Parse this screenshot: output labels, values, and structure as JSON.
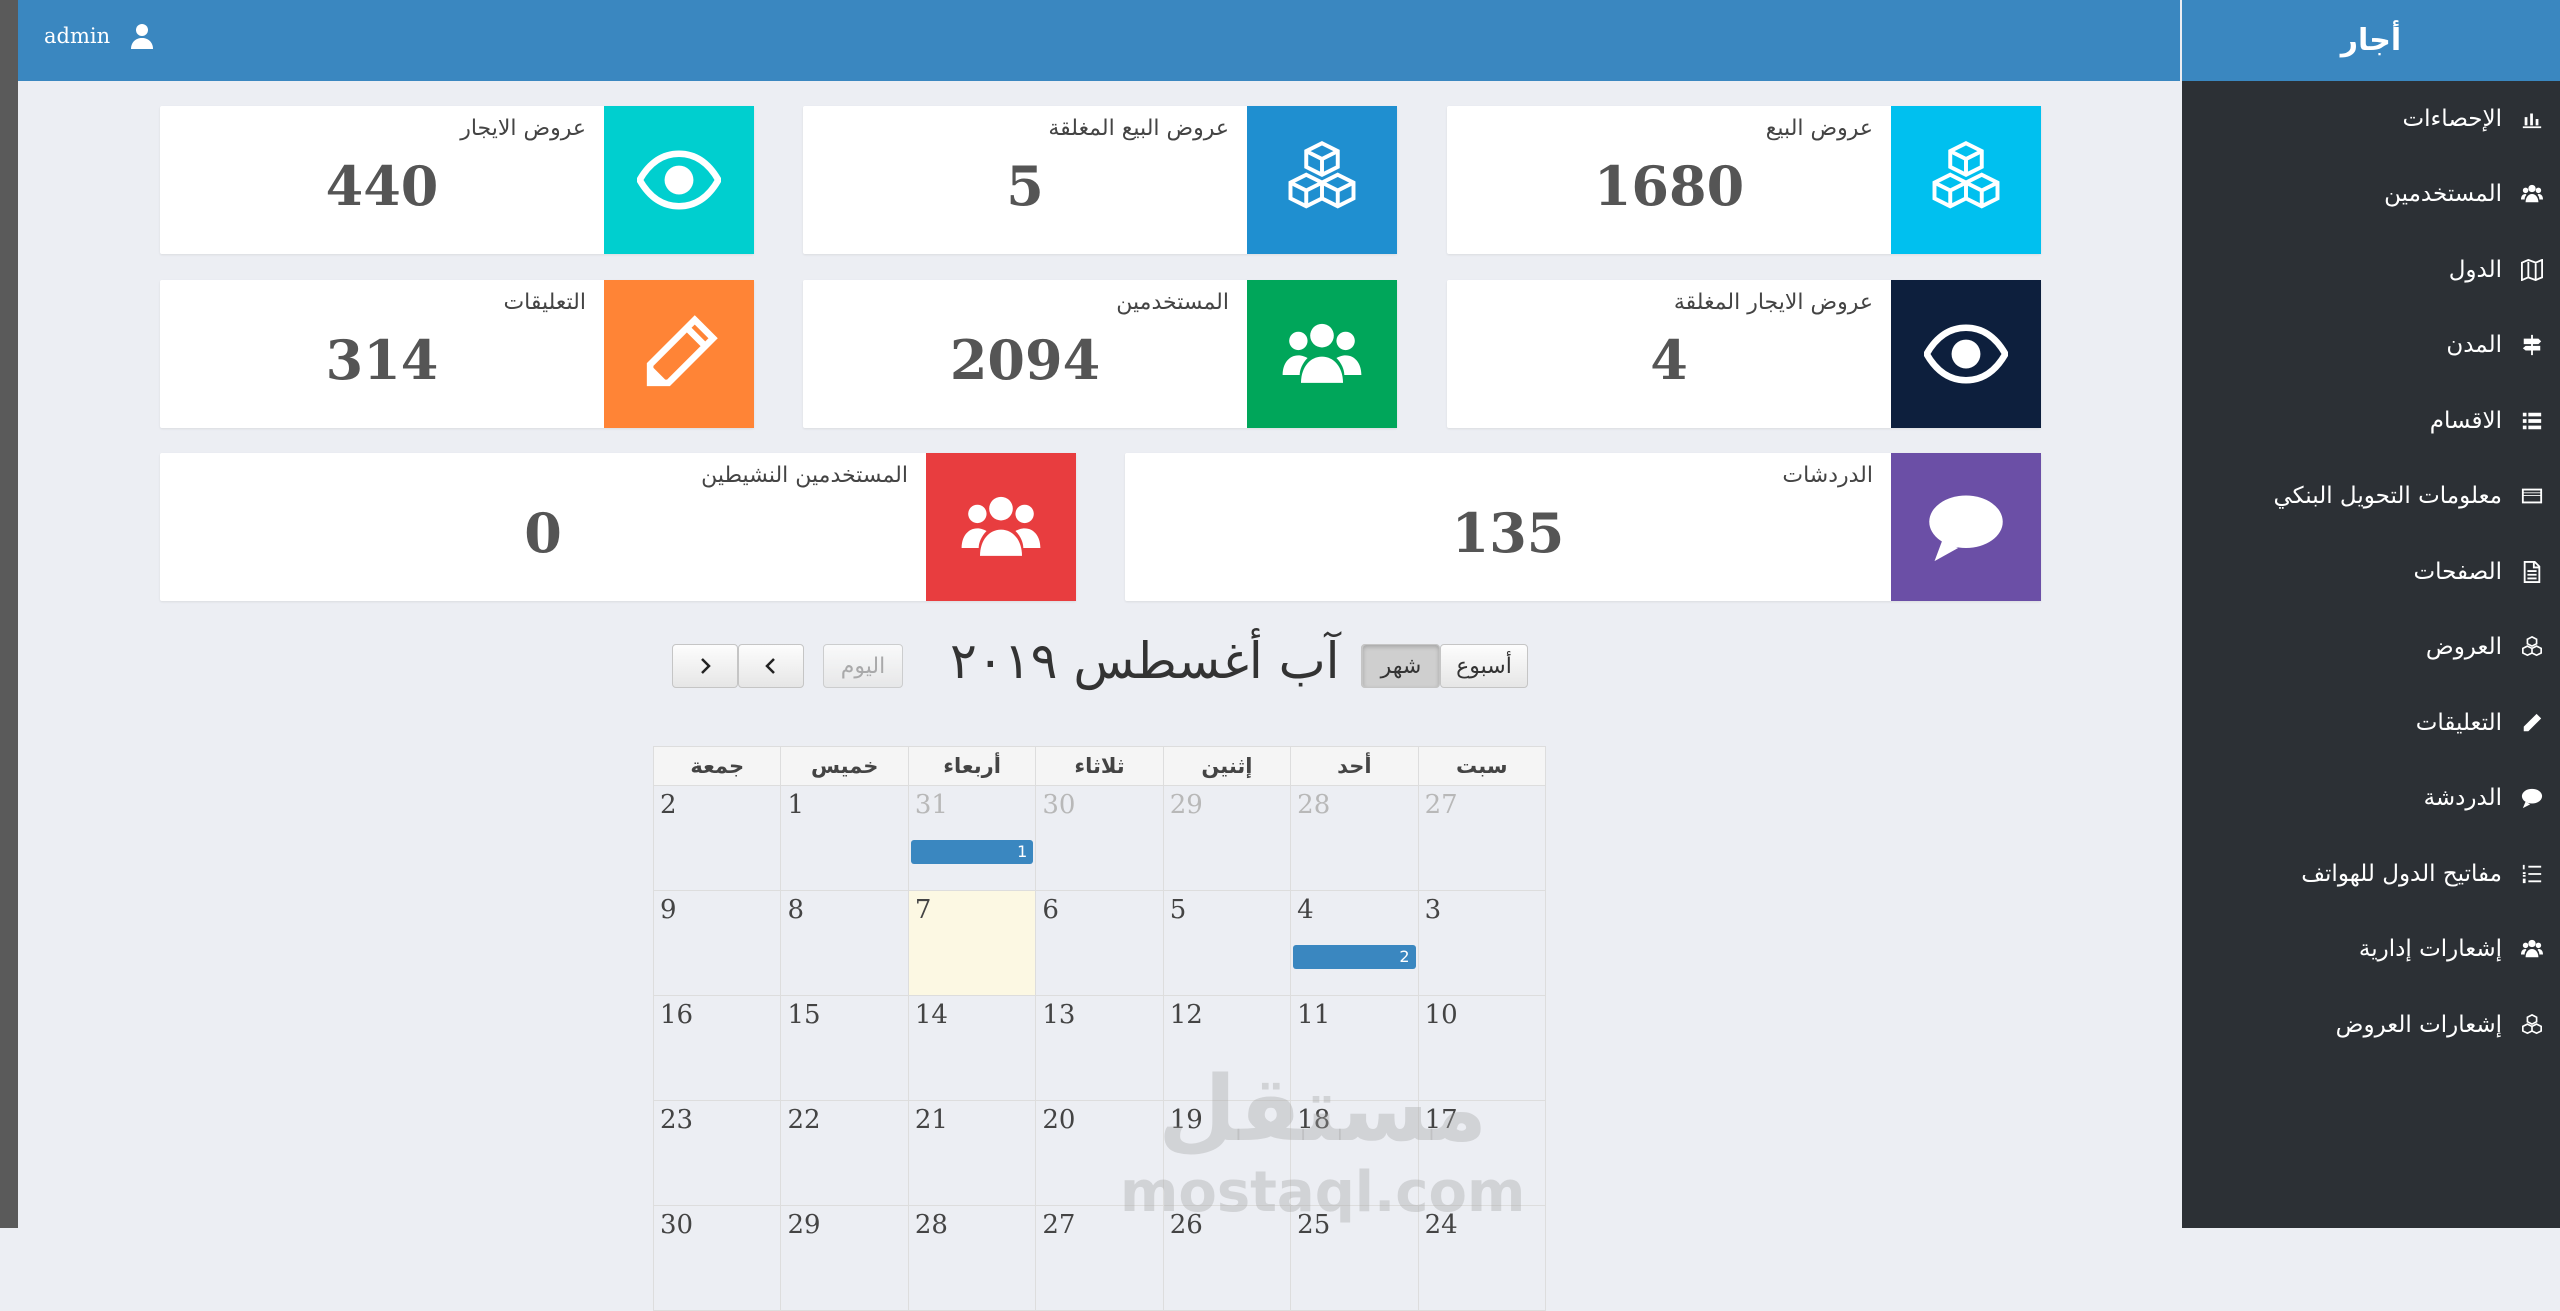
{
  "topbar": {
    "user": "admin"
  },
  "sidebar": {
    "brand": "أجار",
    "items": [
      {
        "label": "الإحصاءات",
        "icon": "bar-chart-icon"
      },
      {
        "label": "المستخدمين",
        "icon": "users-icon"
      },
      {
        "label": "الدول",
        "icon": "map-icon"
      },
      {
        "label": "المدن",
        "icon": "signpost-icon"
      },
      {
        "label": "الاقسام",
        "icon": "list-icon"
      },
      {
        "label": "معلومات التحويل البنكي",
        "icon": "credit-card-icon"
      },
      {
        "label": "الصفحات",
        "icon": "file-icon"
      },
      {
        "label": "العروض",
        "icon": "cubes-icon"
      },
      {
        "label": "التعليقات",
        "icon": "pencil-icon"
      },
      {
        "label": "الدردشة",
        "icon": "comment-icon"
      },
      {
        "label": "مفاتيح الدول للهواتف",
        "icon": "list-ol-icon"
      },
      {
        "label": "إشعارات إدارية",
        "icon": "users-icon"
      },
      {
        "label": "إشعارات العروض",
        "icon": "cubes-icon"
      }
    ]
  },
  "stats": {
    "sale_offers": {
      "label": "عروض البيع",
      "value": "1680",
      "color": "#00c0ef"
    },
    "closed_sale_offers": {
      "label": "عروض البيع المغلقة",
      "value": "5",
      "color": "#1f8fd0"
    },
    "rent_offers": {
      "label": "عروض الايجار",
      "value": "440",
      "color": "#00cfcf"
    },
    "closed_rent_offers": {
      "label": "عروض الايجار المغلقة",
      "value": "4",
      "color": "#0d1f3d"
    },
    "users": {
      "label": "المستخدمين",
      "value": "2094",
      "color": "#00a65a"
    },
    "comments": {
      "label": "التعليقات",
      "value": "314",
      "color": "#ff8436"
    },
    "chats": {
      "label": "الدردشات",
      "value": "135",
      "color": "#6b4fa6"
    },
    "active_users": {
      "label": "المستخدمين النشيطين",
      "value": "0",
      "color": "#e83d3f"
    }
  },
  "calendar": {
    "title": "آب أغسطس ٢٠١٩",
    "view_week": "أسبوع",
    "view_month": "شهر",
    "today": "اليوم",
    "weekdays": [
      "سبت",
      "أحد",
      "إثنين",
      "ثلاثاء",
      "أربعاء",
      "خميس",
      "جمعة"
    ],
    "weeks": [
      [
        {
          "d": "27",
          "o": true
        },
        {
          "d": "28",
          "o": true
        },
        {
          "d": "29",
          "o": true
        },
        {
          "d": "30",
          "o": true
        },
        {
          "d": "31",
          "o": true,
          "ev": "1"
        },
        {
          "d": "1"
        },
        {
          "d": "2"
        }
      ],
      [
        {
          "d": "3"
        },
        {
          "d": "4",
          "ev": "2"
        },
        {
          "d": "5"
        },
        {
          "d": "6"
        },
        {
          "d": "7",
          "today": true
        },
        {
          "d": "8"
        },
        {
          "d": "9"
        }
      ],
      [
        {
          "d": "10"
        },
        {
          "d": "11"
        },
        {
          "d": "12"
        },
        {
          "d": "13"
        },
        {
          "d": "14"
        },
        {
          "d": "15"
        },
        {
          "d": "16"
        }
      ],
      [
        {
          "d": "17"
        },
        {
          "d": "18"
        },
        {
          "d": "19"
        },
        {
          "d": "20"
        },
        {
          "d": "21"
        },
        {
          "d": "22"
        },
        {
          "d": "23"
        }
      ],
      [
        {
          "d": "24"
        },
        {
          "d": "25"
        },
        {
          "d": "26"
        },
        {
          "d": "27"
        },
        {
          "d": "28"
        },
        {
          "d": "29"
        },
        {
          "d": "30"
        }
      ]
    ]
  },
  "watermark": {
    "ar": "مستقل",
    "en": "mostaql.com"
  }
}
